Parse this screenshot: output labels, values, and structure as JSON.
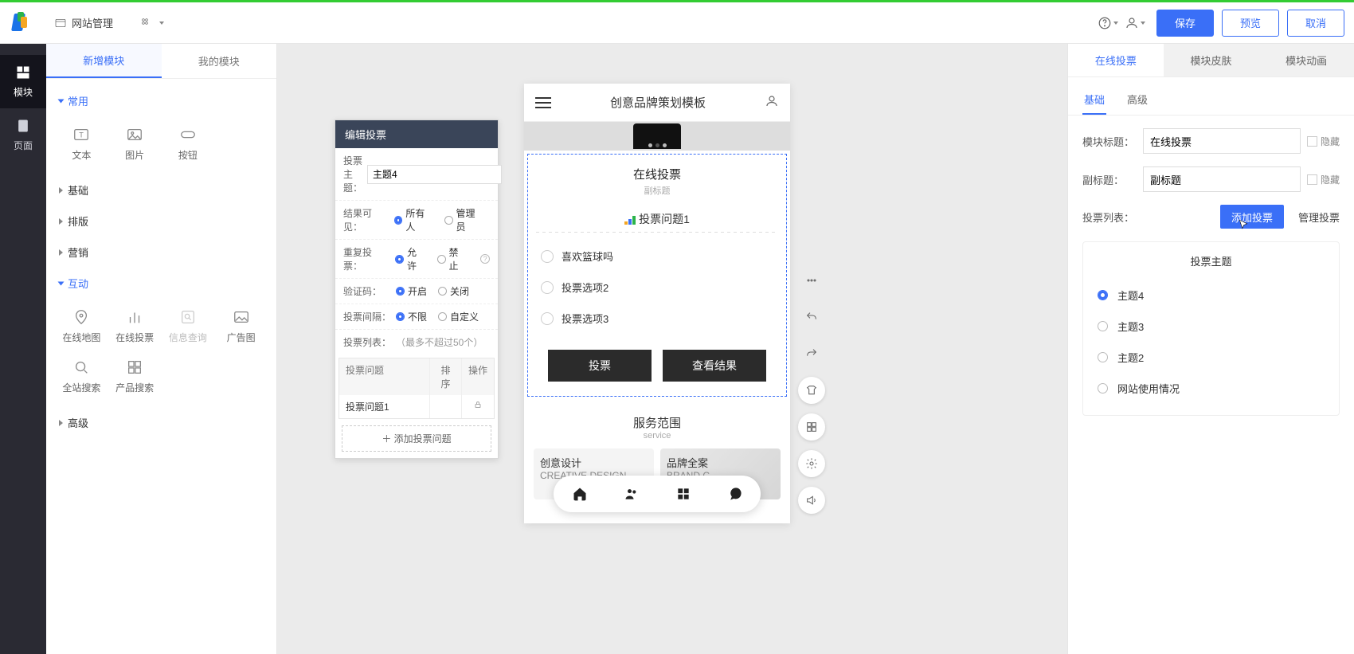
{
  "header": {
    "site_manage": "网站管理",
    "save": "保存",
    "preview": "预览",
    "cancel": "取消"
  },
  "rail": {
    "module": "模块",
    "page": "页面"
  },
  "left": {
    "tab_new": "新增模块",
    "tab_mine": "我的模块",
    "sec_common": "常用",
    "sec_basic": "基础",
    "sec_layout": "排版",
    "sec_marketing": "营销",
    "sec_interact": "互动",
    "sec_advanced": "高级",
    "items_common": {
      "text": "文本",
      "image": "图片",
      "button": "按钮"
    },
    "items_interact": {
      "map": "在线地图",
      "vote": "在线投票",
      "info": "信息查询",
      "ad": "广告图",
      "sitesearch": "全站搜索",
      "prodsearch": "产品搜索"
    }
  },
  "popedit": {
    "title": "编辑投票",
    "theme_label": "投票主题：",
    "theme_value": "主题4",
    "result_label": "结果可见：",
    "result_all": "所有人",
    "result_admin": "管理员",
    "repeat_label": "重复投票：",
    "repeat_allow": "允许",
    "repeat_forbid": "禁止",
    "captcha_label": "验证码：",
    "captcha_on": "开启",
    "captcha_off": "关闭",
    "interval_label": "投票间隔：",
    "interval_unlimit": "不限",
    "interval_custom": "自定义",
    "list_label": "投票列表：",
    "list_hint": "（最多不超过50个）",
    "col_q": "投票问题",
    "col_sort": "排序",
    "col_op": "操作",
    "row_q1": "投票问题1",
    "add_btn": "添加投票问题"
  },
  "phone": {
    "headtitle": "创意品牌策划模板",
    "vote_title": "在线投票",
    "vote_sub": "副标题",
    "vote_q": "投票问题1",
    "opt1": "喜欢篮球吗",
    "opt2": "投票选项2",
    "opt3": "投票选项3",
    "btn_vote": "投票",
    "btn_result": "查看结果",
    "service_t": "服务范围",
    "service_s": "service",
    "card1_t": "创意设计",
    "card1_s": "CREATIVE DESIGN",
    "card2_t": "品牌全案",
    "card2_s": "BRAND C"
  },
  "right": {
    "tab_vote": "在线投票",
    "tab_skin": "模块皮肤",
    "tab_anim": "模块动画",
    "sub_basic": "基础",
    "sub_adv": "高级",
    "mod_title_label": "模块标题：",
    "mod_title_value": "在线投票",
    "sub_title_label": "副标题：",
    "sub_title_value": "副标题",
    "hide": "隐藏",
    "list_label": "投票列表：",
    "add_vote": "添加投票",
    "manage_vote": "管理投票",
    "theme_hd": "投票主题",
    "themes": [
      "主题4",
      "主题3",
      "主题2",
      "网站使用情况"
    ]
  }
}
